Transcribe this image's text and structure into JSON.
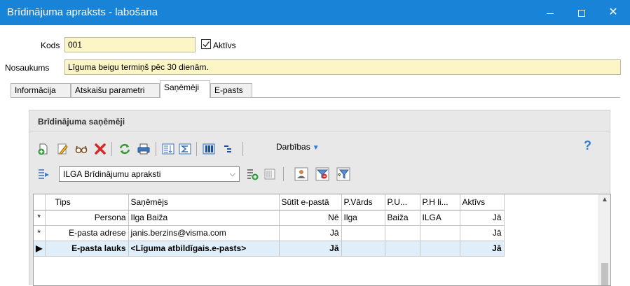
{
  "window": {
    "title": "Brīdinājuma apraksts - labošana",
    "min_icon": "minimize-icon",
    "max_icon": "maximize-icon",
    "close_icon": "close-icon"
  },
  "form": {
    "kods_label": "Kods",
    "kods_value": "001",
    "aktivs_label": "Aktīvs",
    "aktivs_checked": true,
    "nosaukums_label": "Nosaukums",
    "nosaukums_value": "Līguma beigu termiņš pēc 30 dienām."
  },
  "tabs": [
    {
      "label": "Informācija",
      "active": false
    },
    {
      "label": "Atskaišu parametri",
      "active": false
    },
    {
      "label": "Saņēmēji",
      "active": true
    },
    {
      "label": "E-pasts",
      "active": false
    }
  ],
  "panel": {
    "title": "Brīdinājuma saņēmēji",
    "darbibas_label": "Darbības",
    "help_label": "?",
    "combo_value": "ILGA Brīdinājumu apraksti"
  },
  "colors": {
    "titlebar": "#1883d7",
    "field_bg": "#fcf5c5",
    "selected_row": "#dfeef8"
  },
  "grid": {
    "columns": [
      "Tips",
      "Saņēmējs",
      "Sūtīt e-pastā",
      "P.Vārds",
      "P.U...",
      "P.H li...",
      "Aktīvs"
    ],
    "rows": [
      {
        "indicator": "*",
        "tips": "Persona",
        "sanemejs": "Ilga Baiža",
        "sutit": "Nē",
        "pvards": "Ilga",
        "pu": "Baiža",
        "phli": "ILGA",
        "aktivs": "Jā",
        "selected": false
      },
      {
        "indicator": "*",
        "tips": "E-pasta adrese",
        "sanemejs": "janis.berzins@visma.com",
        "sutit": "Jā",
        "pvards": "",
        "pu": "",
        "phli": "",
        "aktivs": "Jā",
        "selected": false
      },
      {
        "indicator": "▶",
        "tips": "E-pasta lauks",
        "sanemejs": "<Līguma atbildīgais.e-pasts>",
        "sutit": "Jā",
        "pvards": "",
        "pu": "",
        "phli": "",
        "aktivs": "Jā",
        "selected": true
      }
    ]
  }
}
